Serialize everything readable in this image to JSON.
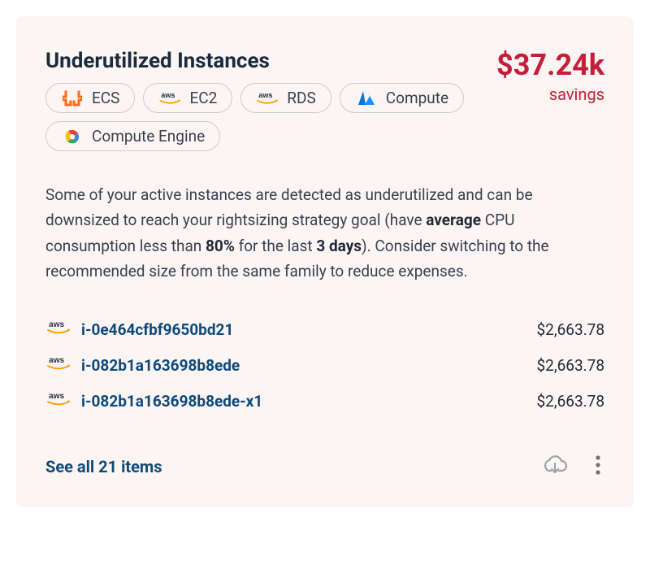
{
  "title": "Underutilized Instances",
  "savings": {
    "amount": "$37.24k",
    "label": "savings"
  },
  "chips": [
    {
      "label": "ECS"
    },
    {
      "label": "EC2"
    },
    {
      "label": "RDS"
    },
    {
      "label": "Compute"
    },
    {
      "label": "Compute Engine"
    }
  ],
  "description": {
    "p1": "Some of your active instances are detected as underutilized and can be downsized to reach your rightsizing strategy goal (have ",
    "b1": "average",
    "p2": " CPU consumption less than ",
    "b2": "80%",
    "p3": " for the last ",
    "b3": "3 days",
    "p4": "). Consider switching to the recommended size from the same family to reduce expenses."
  },
  "instances": [
    {
      "id": "i-0e464cfbf9650bd21",
      "amount": "$2,663.78"
    },
    {
      "id": "i-082b1a163698b8ede",
      "amount": "$2,663.78"
    },
    {
      "id": "i-082b1a163698b8ede-x1",
      "amount": "$2,663.78"
    }
  ],
  "footer": {
    "see_all": "See all 21 items"
  }
}
